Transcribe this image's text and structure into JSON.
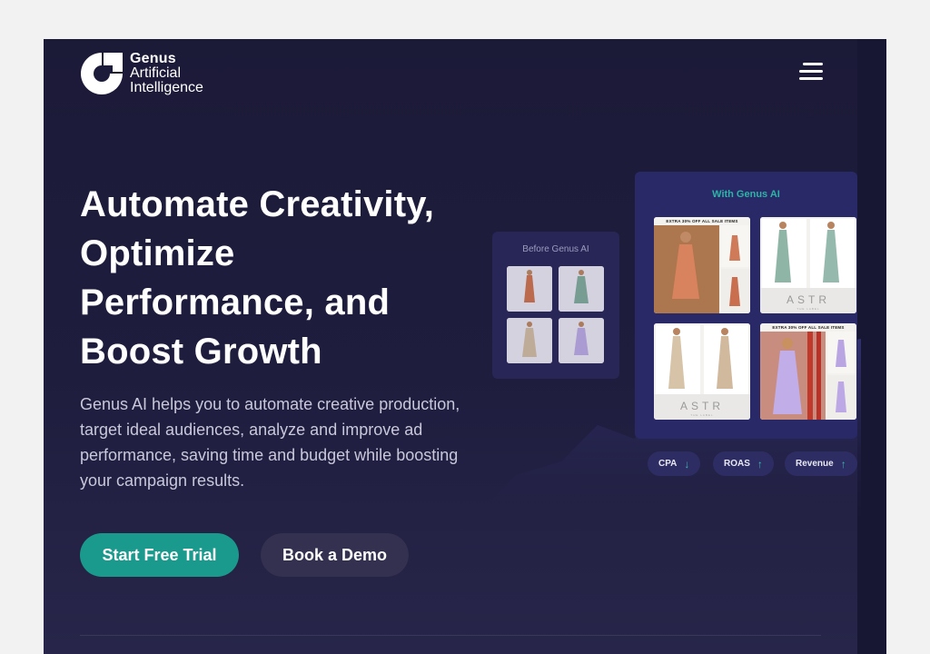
{
  "header": {
    "logo_line1": "Genus",
    "logo_line2": "Artificial",
    "logo_line3": "Intelligence",
    "menu_icon": "hamburger-menu-icon"
  },
  "hero": {
    "title": "Automate Creativity, Optimize Performance, and Boost Growth",
    "description": "Genus AI helps you to automate creative production, target ideal audiences, analyze and improve ad performance, saving time and budget while boosting your campaign results.",
    "primary_cta": "Start Free Trial",
    "secondary_cta": "Book a Demo"
  },
  "illustration": {
    "before_title": "Before Genus AI",
    "after_title": "With Genus AI",
    "ad_banner": "EXTRA 30% OFF ALL SALE ITEMS",
    "ad_brand": "ASTR",
    "ad_brand_sub": "THE LABEL",
    "metrics": [
      {
        "label": "CPA",
        "direction": "down"
      },
      {
        "label": "ROAS",
        "direction": "up"
      },
      {
        "label": "Revenue",
        "direction": "up"
      }
    ]
  },
  "colors": {
    "background": "#1d1c3b",
    "primary_button": "#1a9a8c",
    "secondary_button": "#33314f",
    "accent_teal": "#2bb5a6"
  }
}
